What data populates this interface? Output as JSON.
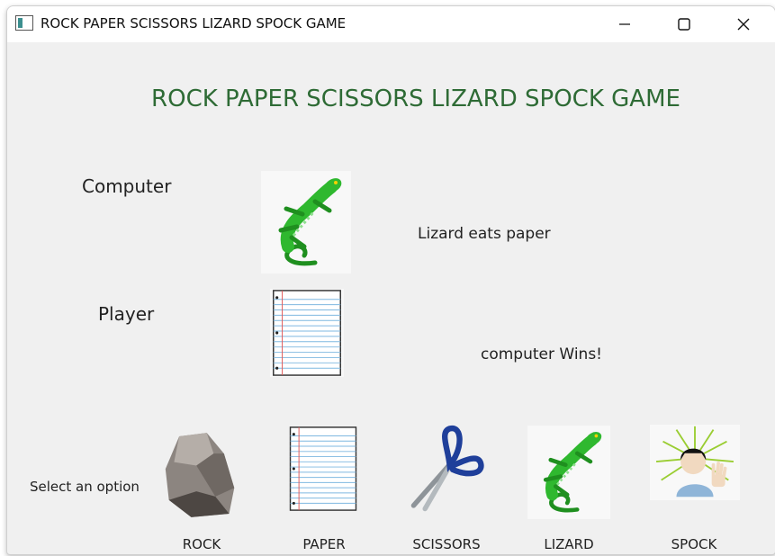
{
  "window": {
    "title": "ROCK PAPER SCISSORS LIZARD SPOCK GAME",
    "controls": [
      "minimize-icon",
      "maximize-icon",
      "close-icon"
    ]
  },
  "header": {
    "title": "ROCK PAPER SCISSORS LIZARD SPOCK GAME"
  },
  "game": {
    "computer_label": "Computer",
    "player_label": "Player",
    "computer_choice_icon": "lizard-icon",
    "player_choice_icon": "paper-icon",
    "rule_text": "Lizard eats paper",
    "result_text": "computer Wins!"
  },
  "options": {
    "prompt": "Select an option",
    "items": [
      {
        "label": "ROCK",
        "icon": "rock-icon"
      },
      {
        "label": "PAPER",
        "icon": "paper-icon"
      },
      {
        "label": "SCISSORS",
        "icon": "scissors-icon"
      },
      {
        "label": "LIZARD",
        "icon": "lizard-icon"
      },
      {
        "label": "SPOCK",
        "icon": "spock-icon"
      }
    ]
  },
  "colors": {
    "title_green": "#2e6b35",
    "background": "#f0f0f0",
    "lizard_green": "#2fb82f"
  }
}
